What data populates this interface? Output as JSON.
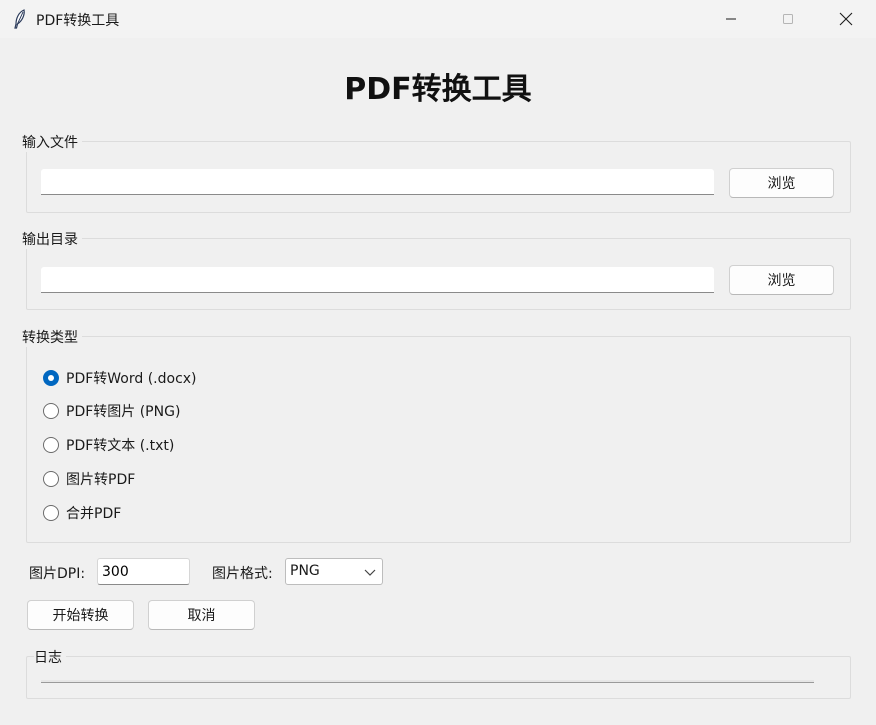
{
  "window": {
    "title": "PDF转换工具"
  },
  "main": {
    "heading": "PDF转换工具"
  },
  "input_group": {
    "label": "输入文件",
    "value": "",
    "browse_label": "浏览"
  },
  "output_group": {
    "label": "输出目录",
    "value": "",
    "browse_label": "浏览"
  },
  "convert_group": {
    "label": "转换类型",
    "options": [
      {
        "label": "PDF转Word (.docx)",
        "checked": true
      },
      {
        "label": "PDF转图片 (PNG)",
        "checked": false
      },
      {
        "label": "PDF转文本 (.txt)",
        "checked": false
      },
      {
        "label": "图片转PDF",
        "checked": false
      },
      {
        "label": "合并PDF",
        "checked": false
      }
    ]
  },
  "options": {
    "dpi_label": "图片DPI:",
    "dpi_value": "300",
    "format_label": "图片格式:",
    "format_value": "PNG"
  },
  "actions": {
    "start_label": "开始转换",
    "cancel_label": "取消"
  },
  "log_group": {
    "label": "日志",
    "progress": 0
  },
  "colors": {
    "accent": "#0067c0",
    "background": "#f0f0f0"
  }
}
